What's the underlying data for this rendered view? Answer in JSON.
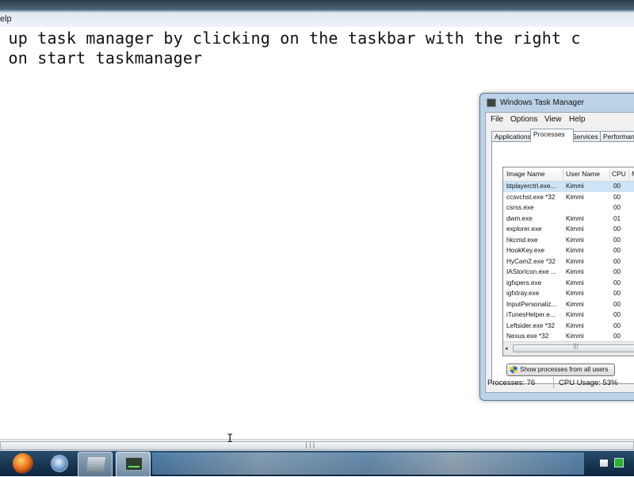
{
  "editor": {
    "menu_help": "elp",
    "lines": [
      "n up task manager by clicking on the taskbar with the right c",
      "k on start taskmanager"
    ],
    "text_cursor": "I"
  },
  "taskbar": {
    "items": [
      "start-button",
      "internet-explorer",
      "windows-explorer",
      "task-manager"
    ]
  },
  "task_manager": {
    "title": "Windows Task Manager",
    "menu": [
      "File",
      "Options",
      "View",
      "Help"
    ],
    "tabs": [
      "Applications",
      "Processes",
      "Services",
      "Performance"
    ],
    "active_tab": "Processes",
    "columns": [
      "Image Name",
      "User Name",
      "CPU",
      "M"
    ],
    "processes": [
      {
        "name": "btplayerctrl.exe...",
        "user": "Kimmi",
        "cpu": "00"
      },
      {
        "name": "ccsvchst.exe *32",
        "user": "Kimmi",
        "cpu": "00"
      },
      {
        "name": "csrss.exe",
        "user": "",
        "cpu": "00"
      },
      {
        "name": "dwm.exe",
        "user": "Kimmi",
        "cpu": "01"
      },
      {
        "name": "explorer.exe",
        "user": "Kimmi",
        "cpu": "00"
      },
      {
        "name": "hkcmd.exe",
        "user": "Kimmi",
        "cpu": "00"
      },
      {
        "name": "HookKey.exe",
        "user": "Kimmi",
        "cpu": "00"
      },
      {
        "name": "HyCam2.exe *32",
        "user": "Kimmi",
        "cpu": "00"
      },
      {
        "name": "IAStorIcon.exe ...",
        "user": "Kimmi",
        "cpu": "00"
      },
      {
        "name": "igfxpers.exe",
        "user": "Kimmi",
        "cpu": "00"
      },
      {
        "name": "igfxtray.exe",
        "user": "Kimmi",
        "cpu": "00"
      },
      {
        "name": "InputPersonaliz...",
        "user": "Kimmi",
        "cpu": "00"
      },
      {
        "name": "iTunesHelper.e...",
        "user": "Kimmi",
        "cpu": "00"
      },
      {
        "name": "Leftsider.exe *32",
        "user": "Kimmi",
        "cpu": "00"
      },
      {
        "name": "Nexus.exe *32",
        "user": "Kimmi",
        "cpu": "00"
      }
    ],
    "show_all_label": "Show processes from all users",
    "status": {
      "processes": "Processes: 76",
      "cpu_usage": "CPU Usage: 53%"
    }
  },
  "colors": {
    "taskbar": "#173550",
    "window_frame": "#bcd2e6",
    "selection": "#cde4f7"
  }
}
